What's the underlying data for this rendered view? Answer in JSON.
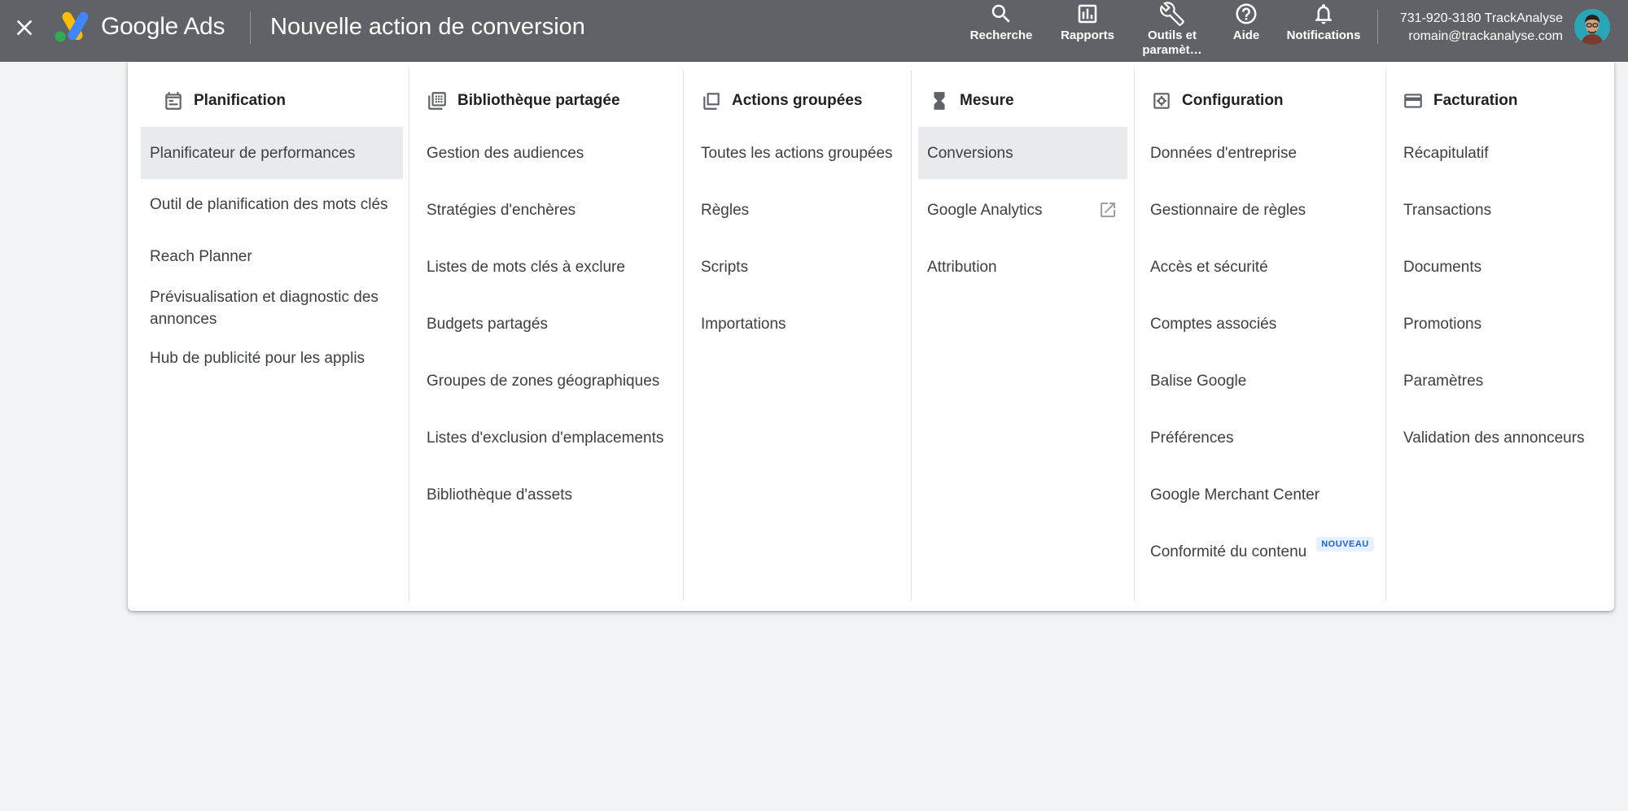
{
  "header": {
    "brand_google": "Google",
    "brand_ads": "Ads",
    "page_title": "Nouvelle action de conversion",
    "tools": [
      {
        "icon": "search-icon",
        "label": "Recherche"
      },
      {
        "icon": "reports-icon",
        "label": "Rapports"
      },
      {
        "icon": "wrench-icon",
        "label": "Outils et\nparamèt…"
      },
      {
        "icon": "help-icon",
        "label": "Aide"
      },
      {
        "icon": "bell-icon",
        "label": "Notifications"
      }
    ],
    "account_line1": "731-920-3180 TrackAnalyse",
    "account_line2": "romain@trackanalyse.com"
  },
  "menu": {
    "columns": [
      {
        "title": "Planification",
        "icon": "calendar-icon",
        "items": [
          {
            "label": "Planificateur de performances",
            "active": true
          },
          {
            "label": "Outil de planification des mots clés"
          },
          {
            "label": "Reach Planner"
          },
          {
            "label": "Prévisualisation et diagnostic des annonces"
          },
          {
            "label": "Hub de publicité pour les applis"
          }
        ]
      },
      {
        "title": "Bibliothèque partagée",
        "icon": "library-icon",
        "items": [
          {
            "label": "Gestion des audiences"
          },
          {
            "label": "Stratégies d'enchères"
          },
          {
            "label": "Listes de mots clés à exclure"
          },
          {
            "label": "Budgets partagés"
          },
          {
            "label": "Groupes de zones géographiques"
          },
          {
            "label": "Listes d'exclusion d'emplacements"
          },
          {
            "label": "Bibliothèque d'assets"
          }
        ]
      },
      {
        "title": "Actions groupées",
        "icon": "copy-icon",
        "items": [
          {
            "label": "Toutes les actions groupées"
          },
          {
            "label": "Règles"
          },
          {
            "label": "Scripts"
          },
          {
            "label": "Importations"
          }
        ]
      },
      {
        "title": "Mesure",
        "icon": "hourglass-icon",
        "items": [
          {
            "label": "Conversions",
            "active": true
          },
          {
            "label": "Google Analytics",
            "external": true
          },
          {
            "label": "Attribution"
          }
        ]
      },
      {
        "title": "Configuration",
        "icon": "settings-box-icon",
        "items": [
          {
            "label": "Données d'entreprise"
          },
          {
            "label": "Gestionnaire de règles"
          },
          {
            "label": "Accès et sécurité"
          },
          {
            "label": "Comptes associés"
          },
          {
            "label": "Balise Google"
          },
          {
            "label": "Préférences"
          },
          {
            "label": "Google Merchant Center"
          },
          {
            "label": "Conformité du contenu",
            "badge": "NOUVEAU"
          }
        ]
      },
      {
        "title": "Facturation",
        "icon": "credit-card-icon",
        "items": [
          {
            "label": "Récapitulatif"
          },
          {
            "label": "Transactions"
          },
          {
            "label": "Documents"
          },
          {
            "label": "Promotions"
          },
          {
            "label": "Paramètres"
          },
          {
            "label": "Validation des annonceurs"
          }
        ]
      }
    ]
  }
}
